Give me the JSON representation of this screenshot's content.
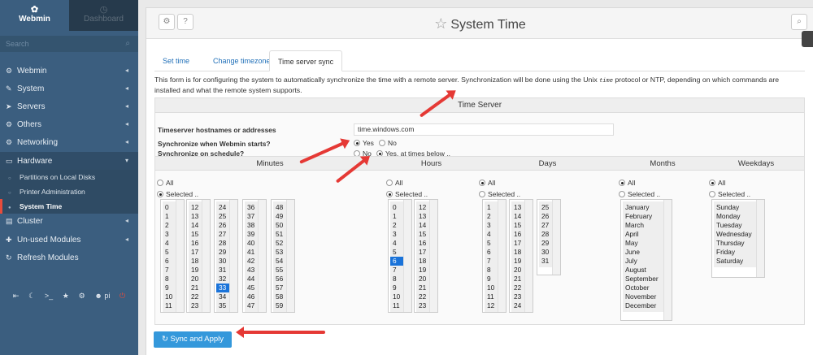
{
  "sidebar": {
    "brand": "Webmin",
    "dashboard": "Dashboard",
    "search_placeholder": "Search",
    "items": [
      {
        "label": "Webmin",
        "icon": "gear-icon"
      },
      {
        "label": "System",
        "icon": "wrench-icon"
      },
      {
        "label": "Servers",
        "icon": "rocket-icon"
      },
      {
        "label": "Others",
        "icon": "gear-icon"
      },
      {
        "label": "Networking",
        "icon": "network-icon"
      },
      {
        "label": "Hardware",
        "icon": "hdd-icon"
      },
      {
        "label": "Cluster",
        "icon": "server-icon"
      },
      {
        "label": "Un-used Modules",
        "icon": "puzzle-icon"
      },
      {
        "label": "Refresh Modules",
        "icon": "refresh-icon"
      }
    ],
    "sub_items": [
      "Partitions on Local Disks",
      "Printer Administration",
      "System Time"
    ],
    "user": "pi"
  },
  "header": {
    "title": "System Time"
  },
  "tabs": [
    "Set time",
    "Change timezone",
    "Time server sync"
  ],
  "intro": {
    "text1": "This form is for configuring the system to automatically synchronize the time with a remote server. Synchronization will be done using the Unix ",
    "code": "time",
    "text2": " protocol or NTP, depending on which commands are installed and what the remote system supports."
  },
  "form": {
    "section_title": "Time Server",
    "ts_label": "Timeserver hostnames or addresses",
    "ts_value": "time.windows.com",
    "sync_start_label": "Synchronize when Webmin starts?",
    "yes": "Yes",
    "no": "No",
    "sync_sched_label": "Synchronize on schedule?",
    "no2": "No",
    "yes_times": "Yes, at times below ..",
    "columns": [
      "Minutes",
      "Hours",
      "Days",
      "Months",
      "Weekdays"
    ],
    "all": "All",
    "selected": "Selected .."
  },
  "lists": {
    "minutes": [
      [
        "0",
        "1",
        "2",
        "3",
        "4",
        "5",
        "6",
        "7",
        "8",
        "9",
        "10",
        "11"
      ],
      [
        "12",
        "13",
        "14",
        "15",
        "16",
        "17",
        "18",
        "19",
        "20",
        "21",
        "22",
        "23"
      ],
      [
        "24",
        "25",
        "26",
        "27",
        "28",
        "29",
        "30",
        "31",
        "32",
        "33",
        "34",
        "35"
      ],
      [
        "36",
        "37",
        "38",
        "39",
        "40",
        "41",
        "42",
        "43",
        "44",
        "45",
        "46",
        "47"
      ],
      [
        "48",
        "49",
        "50",
        "51",
        "52",
        "53",
        "54",
        "55",
        "56",
        "57",
        "58",
        "59"
      ]
    ],
    "hours": [
      [
        "0",
        "1",
        "2",
        "3",
        "4",
        "5",
        "6",
        "7",
        "8",
        "9",
        "10",
        "11"
      ],
      [
        "12",
        "13",
        "14",
        "15",
        "16",
        "17",
        "18",
        "19",
        "20",
        "21",
        "22",
        "23"
      ]
    ],
    "days": [
      [
        "1",
        "2",
        "3",
        "4",
        "5",
        "6",
        "7",
        "8",
        "9",
        "10",
        "11",
        "12"
      ],
      [
        "13",
        "14",
        "15",
        "16",
        "17",
        "18",
        "19",
        "20",
        "21",
        "22",
        "23",
        "24"
      ],
      [
        "25",
        "26",
        "27",
        "28",
        "29",
        "30",
        "31"
      ]
    ],
    "months": [
      "January",
      "February",
      "March",
      "April",
      "May",
      "June",
      "July",
      "August",
      "September",
      "October",
      "November",
      "December"
    ],
    "weekdays": [
      "Sunday",
      "Monday",
      "Tuesday",
      "Wednesday",
      "Thursday",
      "Friday",
      "Saturday"
    ],
    "selected_minute": "33",
    "selected_hour": "6"
  },
  "apply_label": "Sync and Apply"
}
